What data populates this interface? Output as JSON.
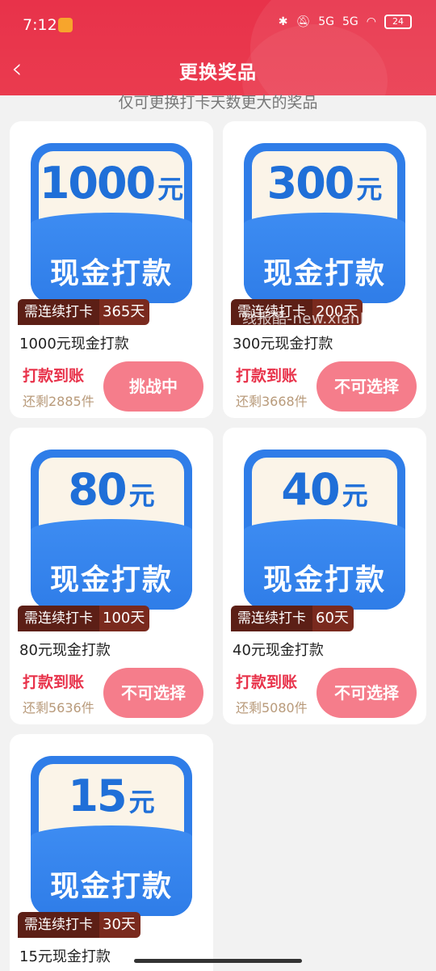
{
  "status": {
    "time": "7:12",
    "battery": "24",
    "signal1": "5G",
    "signal2": "5G"
  },
  "nav": {
    "title": "更换奖品"
  },
  "subtitle": "仅可更换打卡天数更大的奖品",
  "watermark": "线报酷-new.xianbao.fun",
  "cards": [
    {
      "amount": "1000",
      "unit": "元",
      "label": "现金打款",
      "badge_text": "需连续打卡",
      "days": "365",
      "days_unit": "天",
      "name": "1000元现金打款",
      "payout": "打款到账",
      "remaining": "还剩2885件",
      "button": "挑战中"
    },
    {
      "amount": "300",
      "unit": "元",
      "label": "现金打款",
      "badge_text": "需连续打卡",
      "days": "200",
      "days_unit": "天",
      "name": "300元现金打款",
      "payout": "打款到账",
      "remaining": "还剩3668件",
      "button": "不可选择"
    },
    {
      "amount": "80",
      "unit": "元",
      "label": "现金打款",
      "badge_text": "需连续打卡",
      "days": "100",
      "days_unit": "天",
      "name": "80元现金打款",
      "payout": "打款到账",
      "remaining": "还剩5636件",
      "button": "不可选择"
    },
    {
      "amount": "40",
      "unit": "元",
      "label": "现金打款",
      "badge_text": "需连续打卡",
      "days": "60",
      "days_unit": "天",
      "name": "40元现金打款",
      "payout": "打款到账",
      "remaining": "还剩5080件",
      "button": "不可选择"
    },
    {
      "amount": "15",
      "unit": "元",
      "label": "现金打款",
      "badge_text": "需连续打卡",
      "days": "30",
      "days_unit": "天",
      "name": "15元现金打款",
      "payout": "",
      "remaining": "",
      "button": ""
    }
  ],
  "colors": {
    "header": "#e8324a",
    "voucher": "#2f7de8",
    "button": "#f57d8b"
  }
}
